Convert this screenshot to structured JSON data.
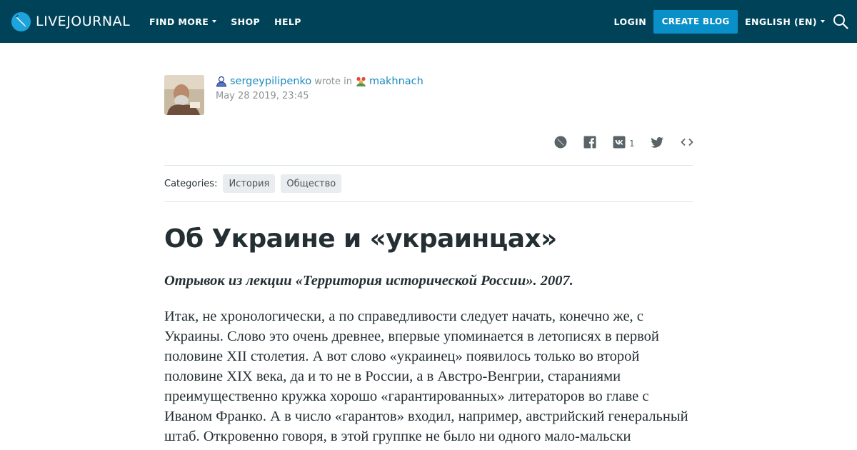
{
  "header": {
    "logo_text": "LIVEJOURNAL",
    "nav": [
      {
        "label": "FIND MORE",
        "has_dropdown": true
      },
      {
        "label": "SHOP",
        "has_dropdown": false
      },
      {
        "label": "HELP",
        "has_dropdown": false
      }
    ],
    "login_label": "LOGIN",
    "create_blog_label": "CREATE BLOG",
    "language_label": "ENGLISH (EN)",
    "colors": {
      "bar": "#004359",
      "button": "#0a90c8"
    }
  },
  "post": {
    "author": "sergeypilipenko",
    "wrote_in": "wrote in",
    "community": "makhnach",
    "date": "May 28 2019, 23:45",
    "share": {
      "icons": [
        "livejournal-icon",
        "facebook-icon",
        "vk-icon",
        "twitter-icon",
        "embed-icon"
      ],
      "vk_count": "1"
    },
    "categories_label": "Categories:",
    "categories": [
      "История",
      "Общество"
    ],
    "title": "Об Украине и «украинцах»",
    "subtitle": "Отрывок из лекции «Территория исторической России». 2007.",
    "body": "Итак, не хронологически, а по справедливости следует начать, конечно же, с Украины. Слово это очень древнее, впервые упоминается в летописях в первой половине XII столетия. А вот слово «украинец» появилось только во второй половине XIX века, да и то не в России, а в Австро-Венгрии, стараниями преимущественно кружка хорошо «гарантированных» литераторов во главе с Иваном Франко. А в число «гарантов» входил, например, австрийский генеральный штаб. Откровенно говоря, в этой группке не было ни одного мало-мальски заметного писателя или публициста,"
  },
  "colors": {
    "link": "#1a8ac0",
    "muted": "#8c9396",
    "text": "#242f33",
    "tag_bg": "#e9edef"
  }
}
